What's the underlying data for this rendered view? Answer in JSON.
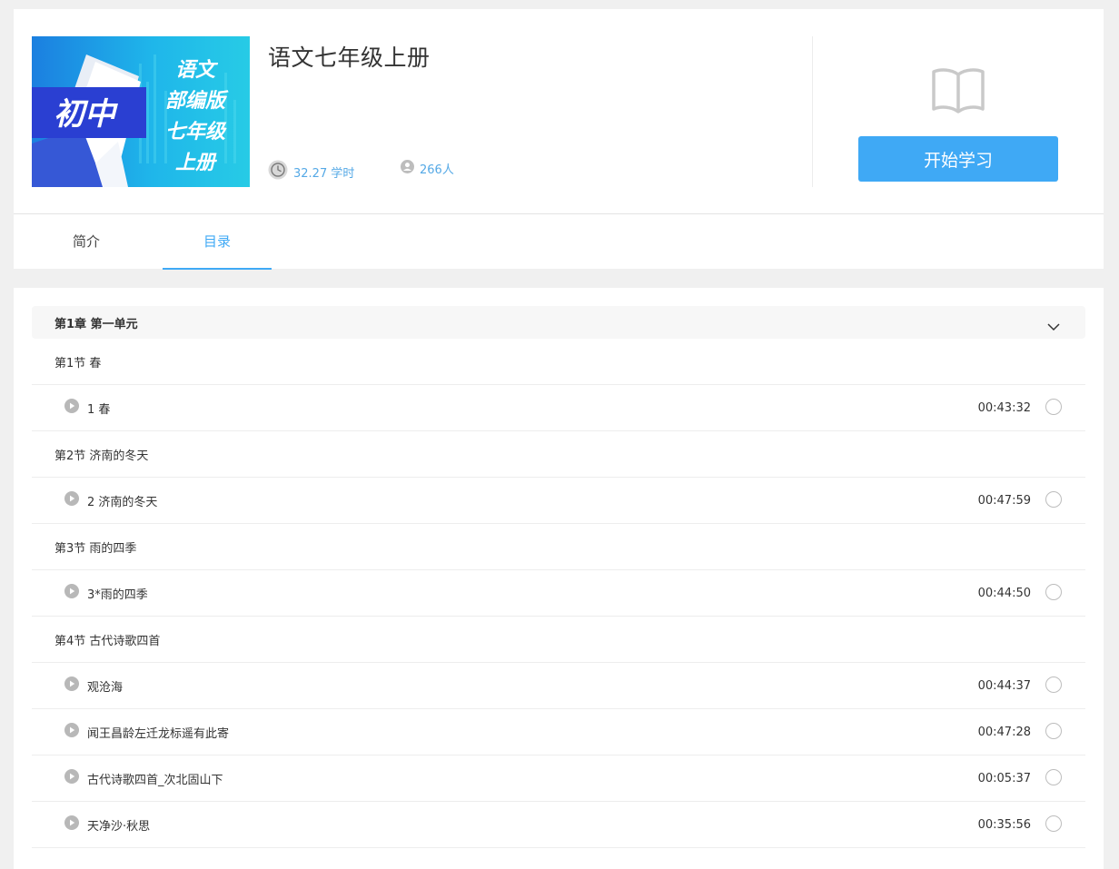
{
  "course": {
    "title": "语文七年级上册",
    "hours": "32.27 学时",
    "people": "266人",
    "start_label": "开始学习",
    "cover": {
      "badge": "初中",
      "line1": "语文",
      "line2": "部编版",
      "line3": "七年级",
      "line4": "上册"
    }
  },
  "tabs": {
    "intro": "简介",
    "catalog": "目录",
    "active": "catalog"
  },
  "colors": {
    "accent": "#3fa9f5",
    "meta_text": "#55a9e6"
  },
  "catalog": {
    "chapter": "第1章 第一单元",
    "rows": [
      {
        "type": "section",
        "label": "第1节 春"
      },
      {
        "type": "lesson",
        "label": "1 春",
        "duration": "00:43:32"
      },
      {
        "type": "section",
        "label": "第2节 济南的冬天"
      },
      {
        "type": "lesson",
        "label": "2 济南的冬天",
        "duration": "00:47:59"
      },
      {
        "type": "section",
        "label": "第3节 雨的四季"
      },
      {
        "type": "lesson",
        "label": "3*雨的四季",
        "duration": "00:44:50"
      },
      {
        "type": "section",
        "label": "第4节 古代诗歌四首"
      },
      {
        "type": "lesson",
        "label": "观沧海",
        "duration": "00:44:37"
      },
      {
        "type": "lesson",
        "label": "闻王昌龄左迁龙标遥有此寄",
        "duration": "00:47:28"
      },
      {
        "type": "lesson",
        "label": "古代诗歌四首_次北固山下",
        "duration": "00:05:37"
      },
      {
        "type": "lesson",
        "label": "天净沙·秋思",
        "duration": "00:35:56"
      }
    ]
  }
}
